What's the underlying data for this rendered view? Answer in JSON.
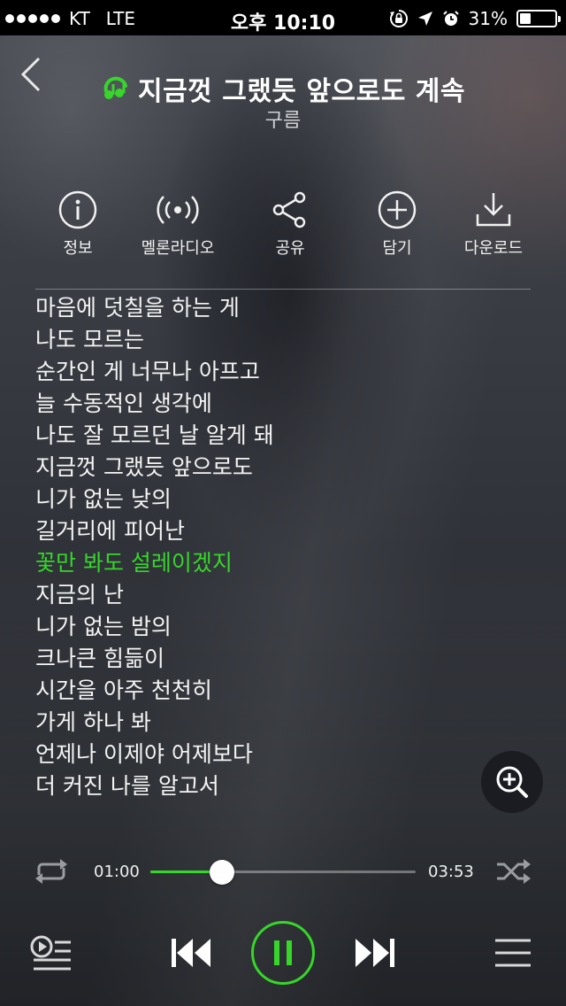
{
  "status_bar": {
    "carrier": "KT",
    "network": "LTE",
    "time": "오후 10:10",
    "battery_text": "31%",
    "battery_level": 0.31
  },
  "header": {
    "back_icon": "chevron-left-icon",
    "music_icon": "music-note-icon",
    "song_title": "지금껏 그랬듯 앞으로도 계속",
    "artist": "구름"
  },
  "actions": [
    {
      "label": "정보",
      "icon": "info-icon"
    },
    {
      "label": "멜론라디오",
      "icon": "radio-icon"
    },
    {
      "label": "공유",
      "icon": "share-icon"
    },
    {
      "label": "담기",
      "icon": "add-icon"
    },
    {
      "label": "다운로드",
      "icon": "download-icon"
    }
  ],
  "lyrics": {
    "current_index": 8,
    "lines": [
      "마음에 덧칠을 하는 게",
      "나도 모르는",
      "순간인 게 너무나 아프고",
      "늘 수동적인 생각에",
      "나도 잘 모르던 날 알게 돼",
      "지금껏 그랬듯 앞으로도",
      "니가 없는 낮의",
      "길거리에 피어난",
      "꽃만 봐도 설레이겠지",
      "지금의 난",
      "니가 없는 밤의",
      "크나큰 힘듦이",
      "시간을 아주 천천히",
      "가게 하나 봐",
      "언제나 이제야 어제보다",
      "더 커진 나를 알고서"
    ]
  },
  "player": {
    "elapsed": "01:00",
    "duration": "03:53",
    "progress": 0.27,
    "repeat_icon": "repeat-icon",
    "shuffle_icon": "shuffle-icon",
    "zoom_icon": "zoom-in-icon",
    "playlist_icon": "playlist-icon",
    "prev_icon": "previous-icon",
    "pause_icon": "pause-icon",
    "next_icon": "next-icon",
    "menu_icon": "menu-icon"
  },
  "colors": {
    "accent": "#36d62a",
    "background": "#3a3d44",
    "status_bar": "#000000"
  }
}
